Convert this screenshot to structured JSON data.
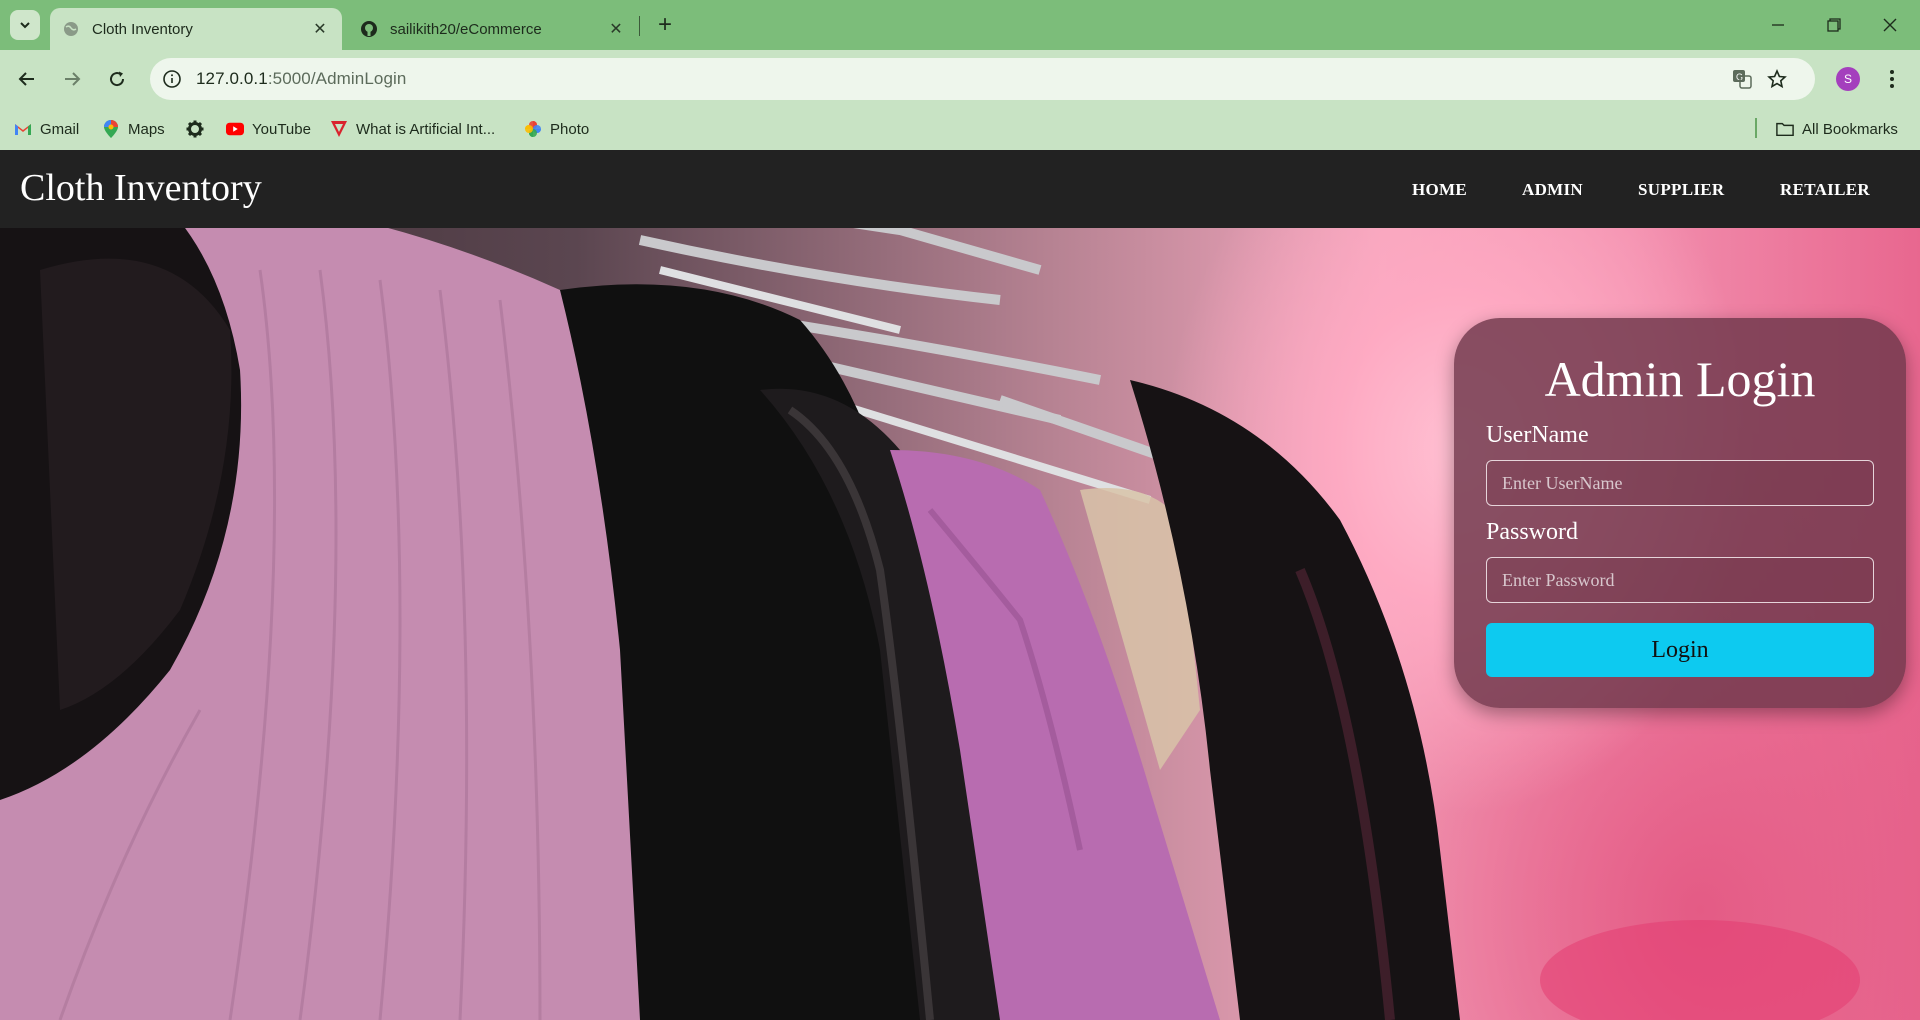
{
  "browser": {
    "tabs": [
      {
        "title": "Cloth Inventory",
        "active": true
      },
      {
        "title": "sailikith20/eCommerce",
        "active": false
      }
    ],
    "address": {
      "host": "127.0.0.1",
      "path": ":5000/AdminLogin"
    },
    "bookmarks": [
      {
        "label": "Gmail",
        "icon": "gmail-icon"
      },
      {
        "label": "Maps",
        "icon": "maps-icon"
      },
      {
        "label": "",
        "icon": "settings-icon"
      },
      {
        "label": "YouTube",
        "icon": "youtube-icon"
      },
      {
        "label": "What is Artificial Int...",
        "icon": "triangle-logo-icon"
      },
      {
        "label": "Photo",
        "icon": "photos-icon"
      }
    ],
    "all_bookmarks": "All Bookmarks",
    "profile_initial": "S"
  },
  "site": {
    "brand": "Cloth Inventory",
    "nav": [
      "HOME",
      "ADMIN",
      "SUPPLIER",
      "RETAILER"
    ]
  },
  "login": {
    "title": "Admin Login",
    "username_label": "UserName",
    "username_placeholder": "Enter UserName",
    "password_label": "Password",
    "password_placeholder": "Enter Password",
    "button": "Login"
  },
  "colors": {
    "tabbar": "#7cbd7a",
    "toolbar": "#c8e3c4",
    "navbar": "#222222",
    "login_button": "#0dcaf0",
    "card": "#6e374b"
  }
}
